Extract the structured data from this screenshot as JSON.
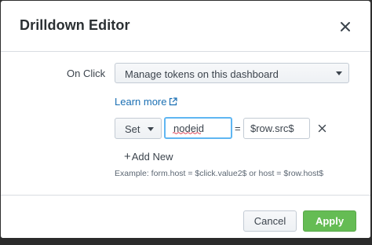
{
  "dialog": {
    "title": "Drilldown Editor",
    "close_icon": "close-icon"
  },
  "on_click": {
    "label": "On Click",
    "selected_option": "Manage tokens on this dashboard"
  },
  "learn_more": {
    "label": "Learn more",
    "icon": "external-link-icon"
  },
  "token_row": {
    "action": "Set",
    "token_name": "nodeid",
    "equals": "=",
    "token_value": "$row.src$",
    "remove_icon": "close-icon"
  },
  "add_new": {
    "plus": "+",
    "label": "Add New"
  },
  "example": "Example: form.host = $click.value2$ or host = $row.host$",
  "footer": {
    "cancel_label": "Cancel",
    "apply_label": "Apply"
  },
  "colors": {
    "apply_bg": "#65bc54",
    "link": "#1a6fb3",
    "focus_border": "#5fb6f2"
  }
}
